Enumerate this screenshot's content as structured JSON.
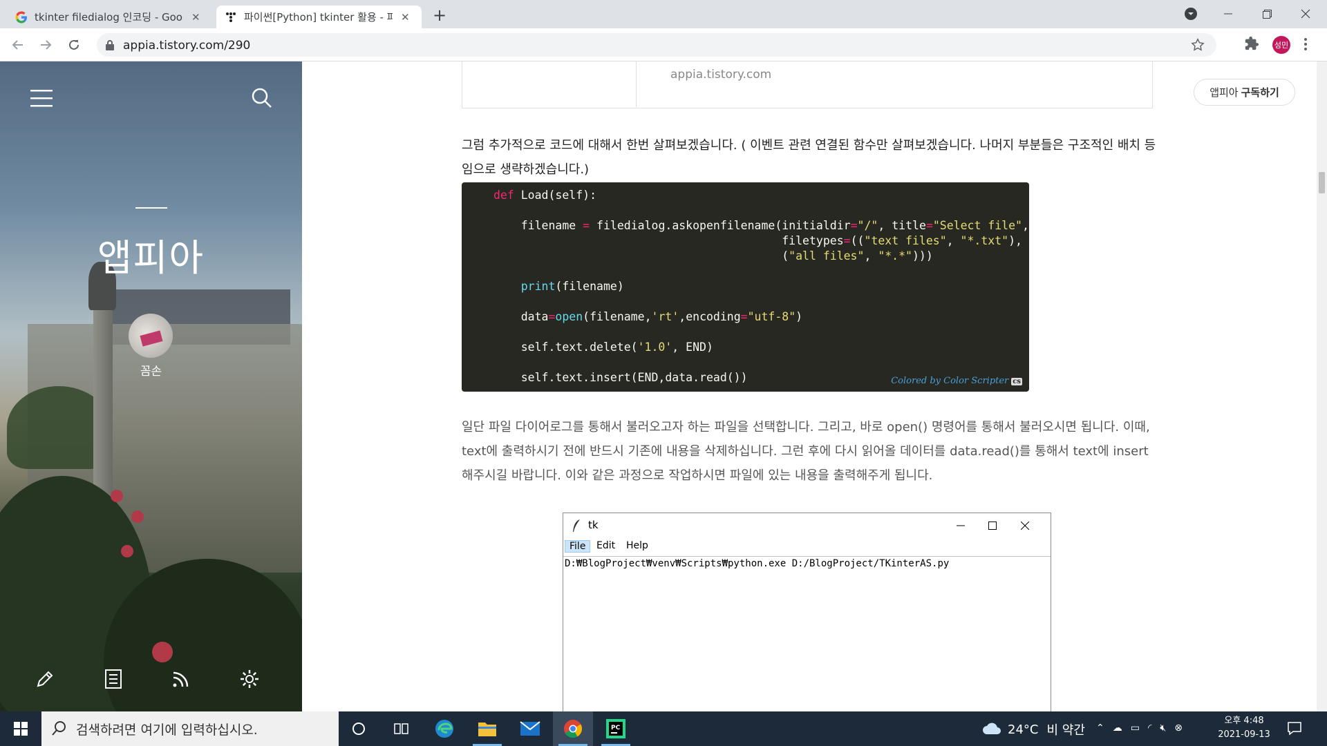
{
  "browser": {
    "tabs": [
      {
        "title": "tkinter filedialog 인코딩 - Goog",
        "favicon": "google-icon",
        "active": false
      },
      {
        "title": "파이썬[Python] tkinter 활용 - 파",
        "favicon": "tistory-icon",
        "active": true
      }
    ],
    "url": "appia.tistory.com/290",
    "profile_initials": "성민",
    "profile_color": "#c2185b"
  },
  "sidebar": {
    "blog_title": "앱피아",
    "author": "꼼손",
    "icons": [
      "menu-icon",
      "search-icon",
      "write-icon",
      "guestbook-icon",
      "rss-icon",
      "settings-icon"
    ]
  },
  "article": {
    "embed_domain": "appia.tistory.com",
    "subscribe": {
      "name": "앱피아",
      "action": "구독하기"
    },
    "paragraph1": "그럼 추가적으로 코드에 대해서 한번 살펴보겠습니다. ( 이벤트 관련 연결된 함수만 살펴보겠습니다. 나머지 부분들은 구조적인 배치 등임으로 생략하겠습니다.)",
    "code_lines": [
      "def Load(self):",
      "",
      "    filename = filedialog.askopenfilename(initialdir=\"/\", title=\"Select file\",",
      "                                          filetypes=((\"text files\", \"*.txt\"),",
      "                                          (\"all files\", \"*.*\")))",
      "",
      "    print(filename)",
      "",
      "    data=open(filename,'rt',encoding=\"utf-8\")",
      "",
      "    self.text.delete('1.0', END)",
      "",
      "    self.text.insert(END,data.read())"
    ],
    "code_credit": "Colored by Color Scripter",
    "code_credit_badge": "cs",
    "paragraph2": "일단 파일 다이어로그를 통해서 불러오고자 하는 파일을 선택합니다. 그리고, 바로 open() 명령어를 통해서 불러오시면 됩니다. 이때, text에 출력하시기 전에 반드시 기존에 내용을 삭제하십니다. 그런 후에 다시 읽어올 데이터를 data.read()를 통해서 text에 insert해주시길 바랍니다. 이와 같은 과정으로 작업하시면 파일에 있는 내용을 출력해주게 됩니다."
  },
  "tk_window": {
    "title": "tk",
    "menu": [
      "File",
      "Edit",
      "Help"
    ],
    "selected_menu": "File",
    "text_line": "D:₩BlogProject₩venv₩Scripts₩python.exe D:/BlogProject/TKinterAS.py"
  },
  "taskbar": {
    "search_placeholder": "검색하려면 여기에 입력하십시오.",
    "apps": [
      "cortana-icon",
      "task-view-icon",
      "edge-icon",
      "file-explorer-icon",
      "mail-icon",
      "chrome-icon",
      "pycharm-icon"
    ],
    "weather": {
      "temp": "24°C",
      "desc": "비 약간"
    },
    "time": "오후 4:48",
    "date": "2021-09-13"
  }
}
